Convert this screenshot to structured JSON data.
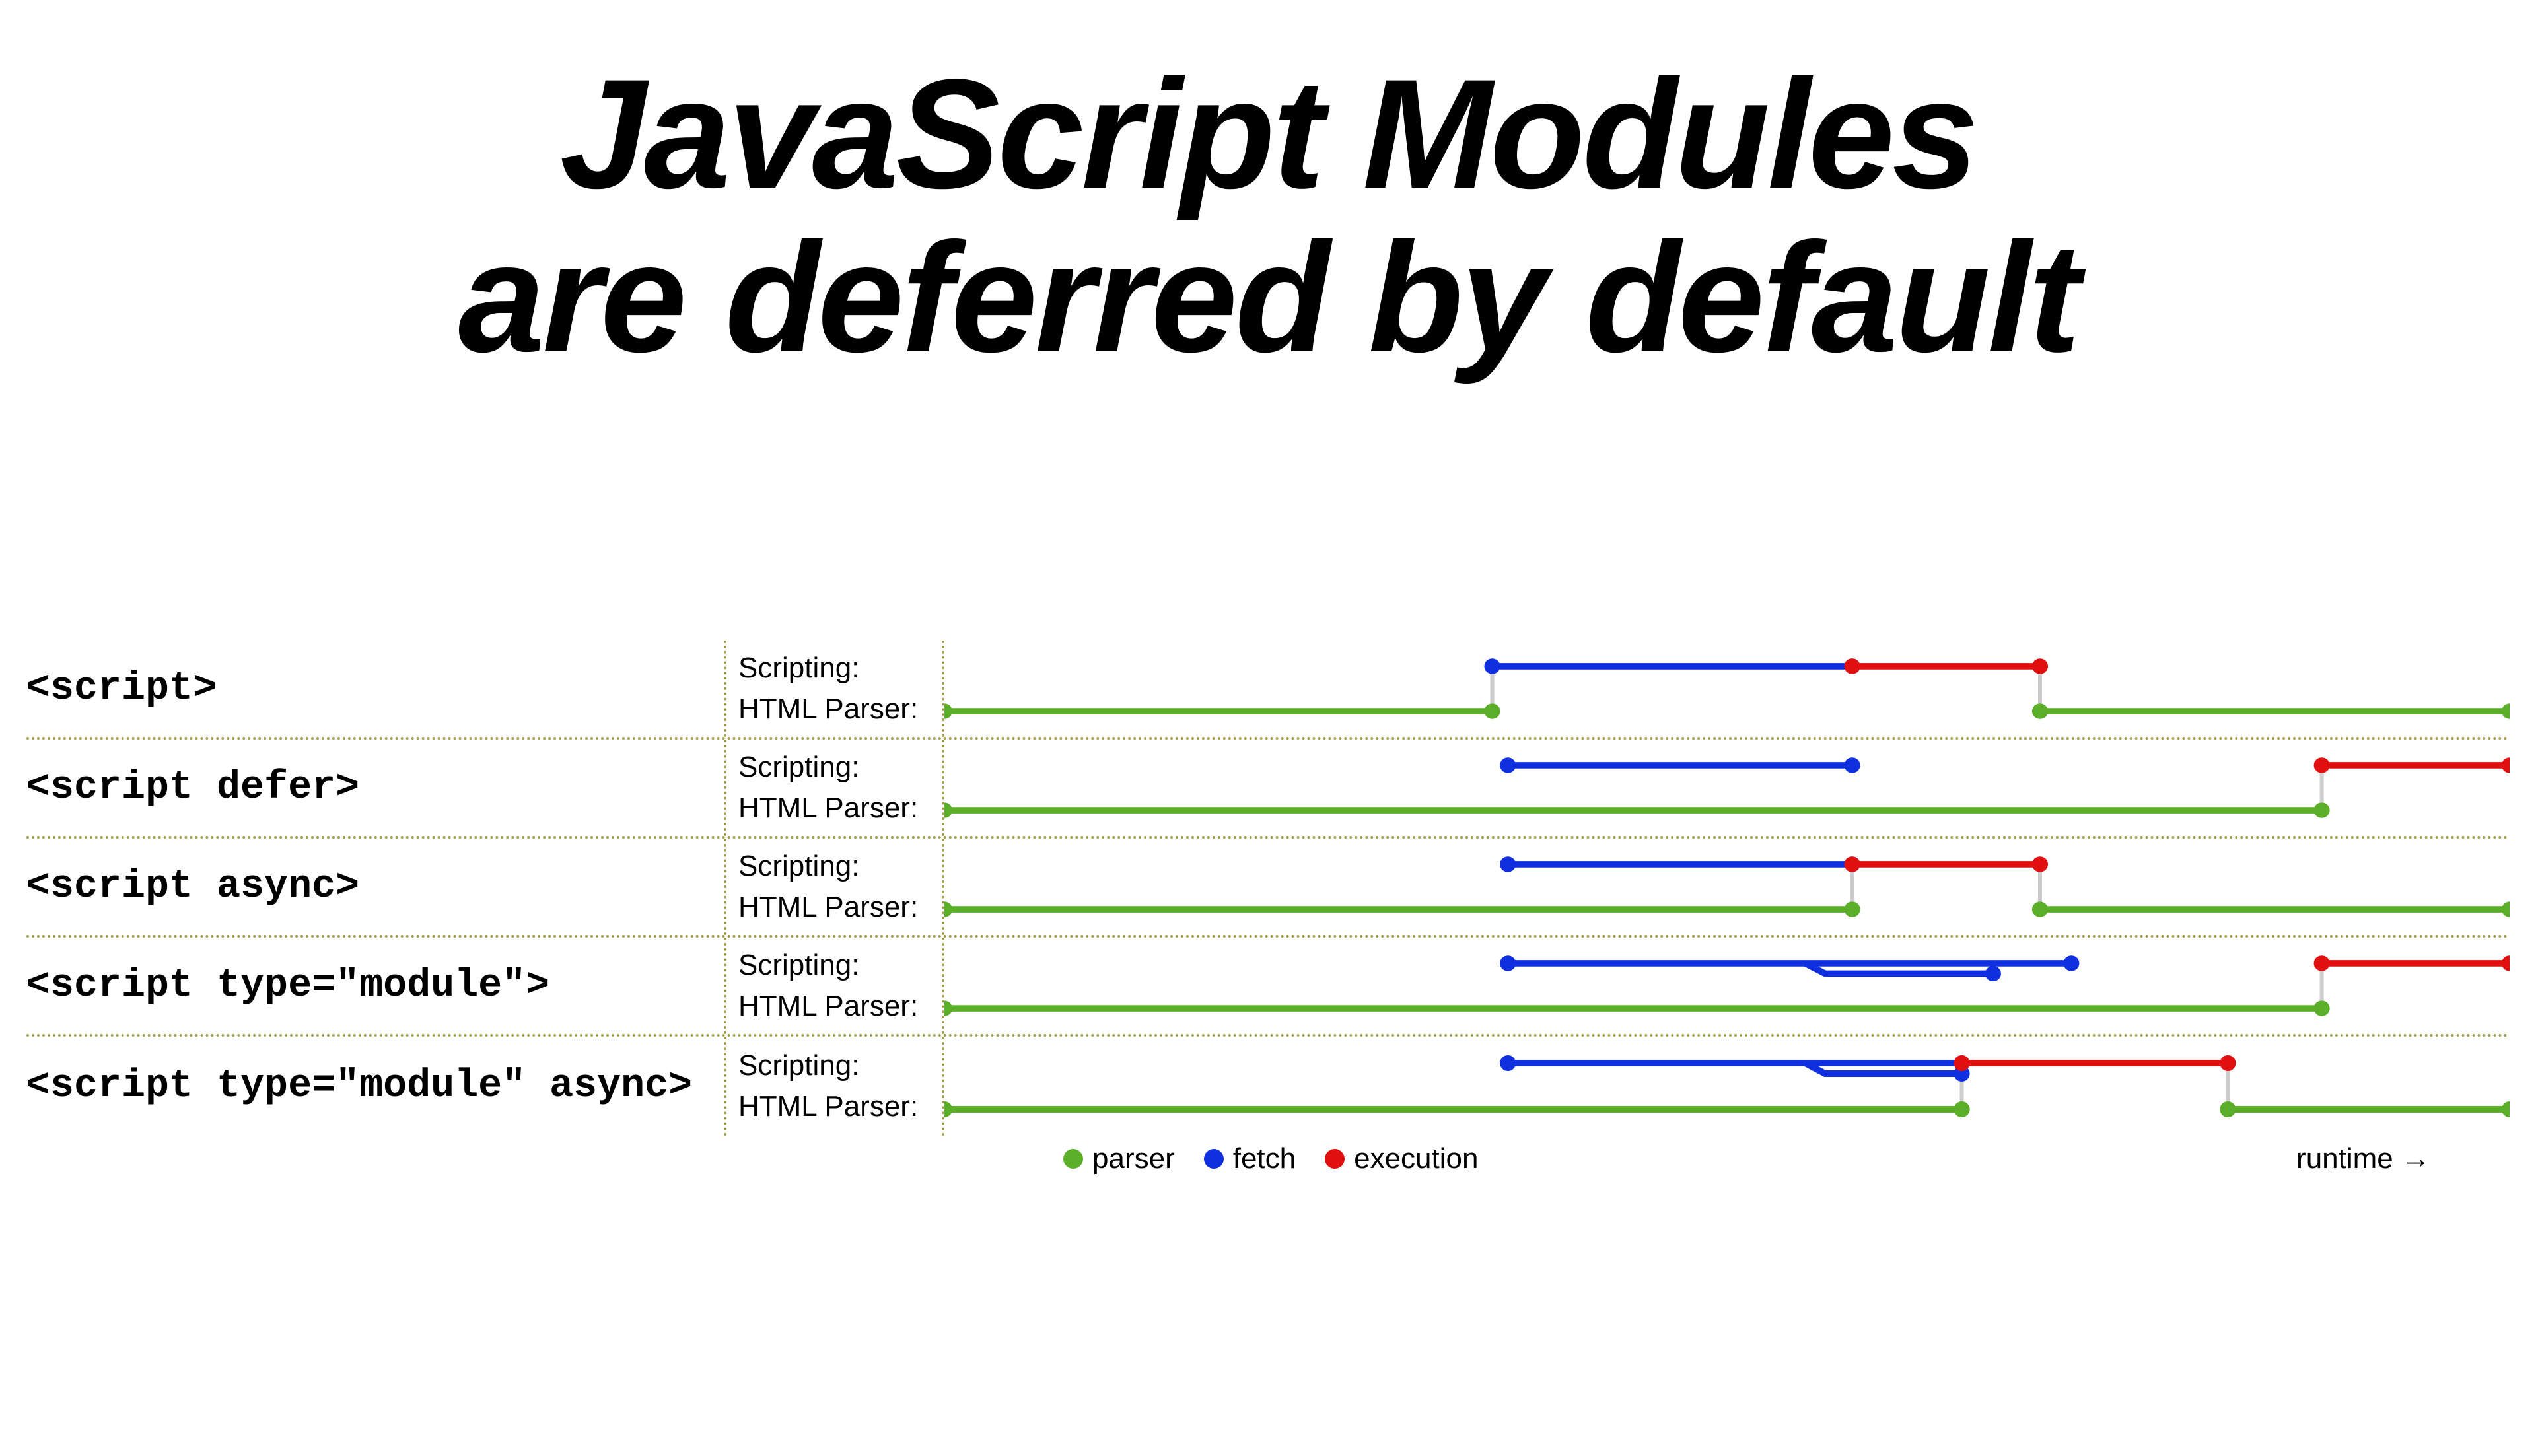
{
  "title_line1": "JavaScript Modules",
  "title_line2": "are deferred by default",
  "labels": {
    "scripting": "Scripting:",
    "parser": "HTML Parser:"
  },
  "legend": {
    "parser": "parser",
    "fetch": "fetch",
    "execution": "execution",
    "runtime": "runtime →"
  },
  "colors": {
    "parser": "#5aae28",
    "fetch": "#1030e0",
    "execution": "#e01010"
  },
  "chart_data": {
    "type": "timeline",
    "xlabel": "runtime",
    "x_range": [
      0,
      100
    ],
    "note": "x values are percentages of runtime axis; connectors are light-grey vertical links between scripting and parser lanes at matching x",
    "rows": [
      {
        "tag": "<script>",
        "scripting": [
          {
            "kind": "fetch",
            "from": 35,
            "to": 58
          },
          {
            "kind": "execution",
            "from": 58,
            "to": 70
          }
        ],
        "parser": [
          {
            "kind": "parser",
            "from": 0,
            "to": 35
          },
          {
            "kind": "parser",
            "from": 70,
            "to": 100
          }
        ],
        "connectors": [
          35,
          70
        ]
      },
      {
        "tag": "<script defer>",
        "scripting": [
          {
            "kind": "fetch",
            "from": 36,
            "to": 58
          },
          {
            "kind": "execution",
            "from": 88,
            "to": 100
          }
        ],
        "parser": [
          {
            "kind": "parser",
            "from": 0,
            "to": 88
          }
        ],
        "connectors": [
          88
        ]
      },
      {
        "tag": "<script async>",
        "scripting": [
          {
            "kind": "fetch",
            "from": 36,
            "to": 58
          },
          {
            "kind": "execution",
            "from": 58,
            "to": 70
          }
        ],
        "parser": [
          {
            "kind": "parser",
            "from": 0,
            "to": 58
          },
          {
            "kind": "parser",
            "from": 70,
            "to": 100
          }
        ],
        "connectors": [
          58,
          70
        ]
      },
      {
        "tag": "<script type=\"module\">",
        "scripting": [
          {
            "kind": "fetch",
            "from": 36,
            "to": 72
          },
          {
            "kind": "fetch-branch",
            "from": 55,
            "to": 67,
            "y_offset": 16
          },
          {
            "kind": "execution",
            "from": 88,
            "to": 100
          }
        ],
        "parser": [
          {
            "kind": "parser",
            "from": 0,
            "to": 88
          }
        ],
        "connectors": [
          88
        ]
      },
      {
        "tag": "<script type=\"module\" async>",
        "scripting": [
          {
            "kind": "fetch",
            "from": 36,
            "to": 65
          },
          {
            "kind": "fetch-branch",
            "from": 55,
            "to": 65,
            "y_offset": 16
          },
          {
            "kind": "execution",
            "from": 65,
            "to": 82
          }
        ],
        "parser": [
          {
            "kind": "parser",
            "from": 0,
            "to": 65
          },
          {
            "kind": "parser",
            "from": 82,
            "to": 100
          }
        ],
        "connectors": [
          65,
          82
        ]
      }
    ]
  }
}
